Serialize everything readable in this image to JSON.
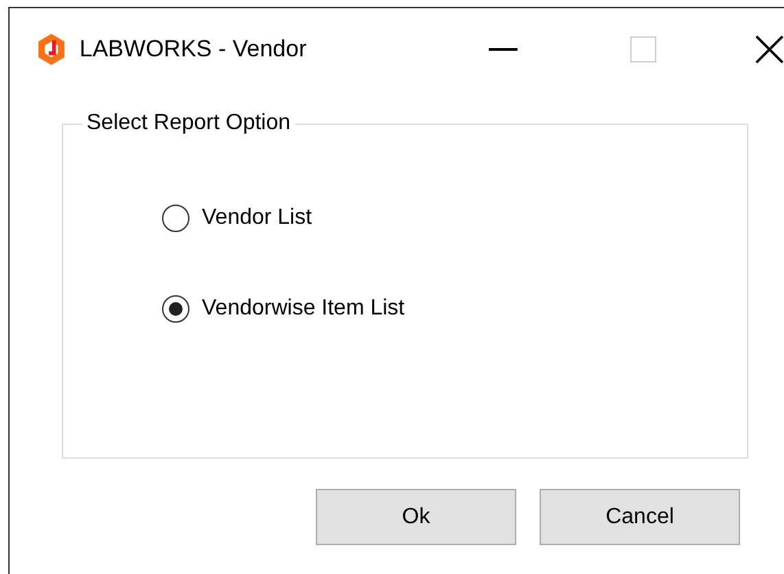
{
  "window": {
    "title": "LABWORKS - Vendor"
  },
  "group": {
    "title": "Select Report Option",
    "options": [
      {
        "label": "Vendor List",
        "selected": false
      },
      {
        "label": "Vendorwise Item List",
        "selected": true
      }
    ]
  },
  "buttons": [
    "Ok",
    "Cancel"
  ]
}
